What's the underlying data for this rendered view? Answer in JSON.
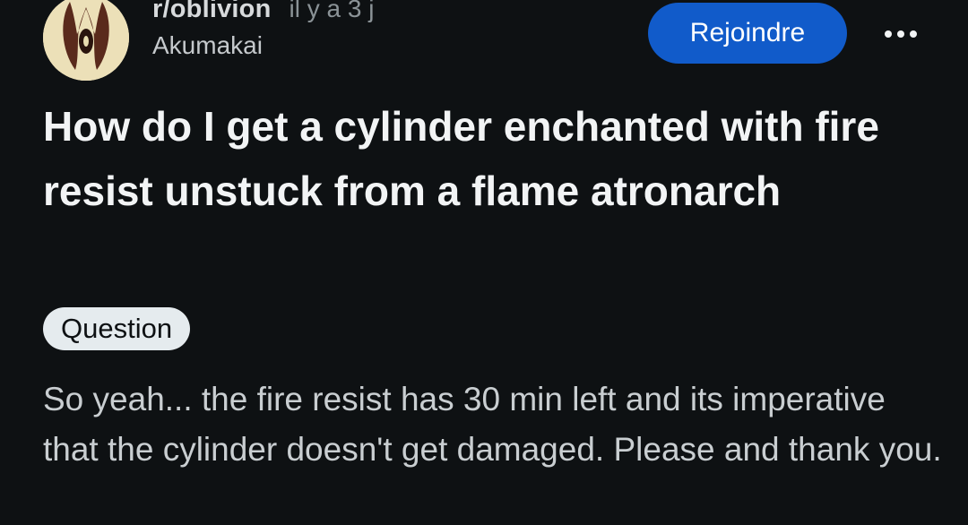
{
  "header": {
    "subreddit": "r/oblivion",
    "timestamp": "il y a 3 j",
    "author": "Akumakai",
    "join_label": "Rejoindre",
    "avatar_icon": "oblivion-sigil-icon",
    "more_icon": "more-horizontal-icon"
  },
  "post": {
    "title": "How do I get a cylinder enchanted with fire resist unstuck from a flame atronarch",
    "flair": "Question",
    "body": "So yeah... the fire resist has 30 min left and its imperative that the cylinder doesn't get damaged. Please and thank you."
  },
  "colors": {
    "background": "#0e1113",
    "join_button": "#115bca",
    "flair_background": "#e5ebee",
    "avatar_background": "#ece0b8"
  }
}
